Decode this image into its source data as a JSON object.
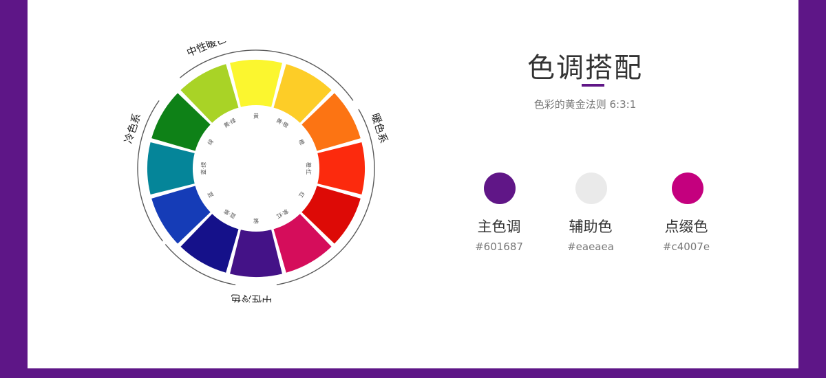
{
  "colors": {
    "frame": "#5e1687",
    "panel": "#ffffff"
  },
  "wheel": {
    "segments": [
      {
        "label": "黄",
        "color": "#fbf62f"
      },
      {
        "label": "黄·橙",
        "color": "#fdcd27"
      },
      {
        "label": "橙",
        "color": "#fc7413"
      },
      {
        "label": "橙·红",
        "color": "#fc2a0d"
      },
      {
        "label": "红",
        "color": "#dd0a06"
      },
      {
        "label": "紫·红",
        "color": "#d50d5b"
      },
      {
        "label": "紫",
        "color": "#441287"
      },
      {
        "label": "蓝·紫",
        "color": "#15118a"
      },
      {
        "label": "蓝",
        "color": "#153cb7"
      },
      {
        "label": "蓝·绿",
        "color": "#058599"
      },
      {
        "label": "绿",
        "color": "#0e8117"
      },
      {
        "label": "黄·绿",
        "color": "#a9d326"
      }
    ],
    "group_labels": {
      "warm_neutral": "中性暖色",
      "warm": "暖色系",
      "cool": "冷色系",
      "cool_neutral": "中性冷色"
    }
  },
  "header": {
    "title": "色调搭配",
    "subtitle": "色彩的黄金法则 6:3:1"
  },
  "swatches": [
    {
      "name": "主色调",
      "hex": "#601687",
      "color": "#601687"
    },
    {
      "name": "辅助色",
      "hex": "#eaeaea",
      "color": "#eaeaea"
    },
    {
      "name": "点缀色",
      "hex": "#c4007e",
      "color": "#c4007e"
    }
  ]
}
